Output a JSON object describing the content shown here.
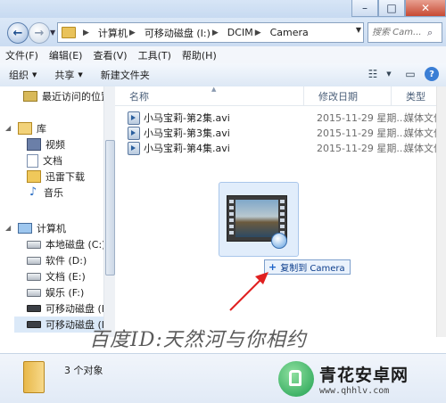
{
  "address": {
    "crumbs": [
      "计算机",
      "可移动磁盘 (I:)",
      "DCIM",
      "Camera"
    ]
  },
  "search": {
    "placeholder": "搜索 Cam..."
  },
  "menubar": {
    "items": [
      "文件(F)",
      "编辑(E)",
      "查看(V)",
      "工具(T)",
      "帮助(H)"
    ]
  },
  "toolbar": {
    "organize": "组织",
    "share": "共享",
    "new_folder": "新建文件夹"
  },
  "nav": {
    "recent": "最近访问的位置",
    "library": "库",
    "videos": "视频",
    "documents": "文档",
    "thunder": "迅雷下载",
    "music": "音乐",
    "computer": "计算机",
    "local_c": "本地磁盘 (C:)",
    "soft_d": "软件 (D:)",
    "doc_e": "文档 (E:)",
    "ent_f": "娱乐 (F:)",
    "removable_h": "可移动磁盘 (H:)",
    "removable_i": "可移动磁盘 (I:)"
  },
  "columns": {
    "name": "名称",
    "date": "修改日期",
    "type": "类型"
  },
  "files": [
    {
      "name": "小马宝莉-第2集.avi",
      "date": "2015-11-29 星期...",
      "type": "媒体文件"
    },
    {
      "name": "小马宝莉-第3集.avi",
      "date": "2015-11-29 星期...",
      "type": "媒体文件"
    },
    {
      "name": "小马宝莉-第4集.avi",
      "date": "2015-11-29 星期...",
      "type": "媒体文件"
    }
  ],
  "drag": {
    "tooltip": "复制到 Camera"
  },
  "watermark": "百度ID:天然河与你相约",
  "details": {
    "count": "3 个对象"
  },
  "site": {
    "name": "青花安卓网",
    "url": "www.qhhlv.com"
  },
  "colors": {
    "arrow": "#e02020",
    "accent": "#3a7ed5"
  }
}
